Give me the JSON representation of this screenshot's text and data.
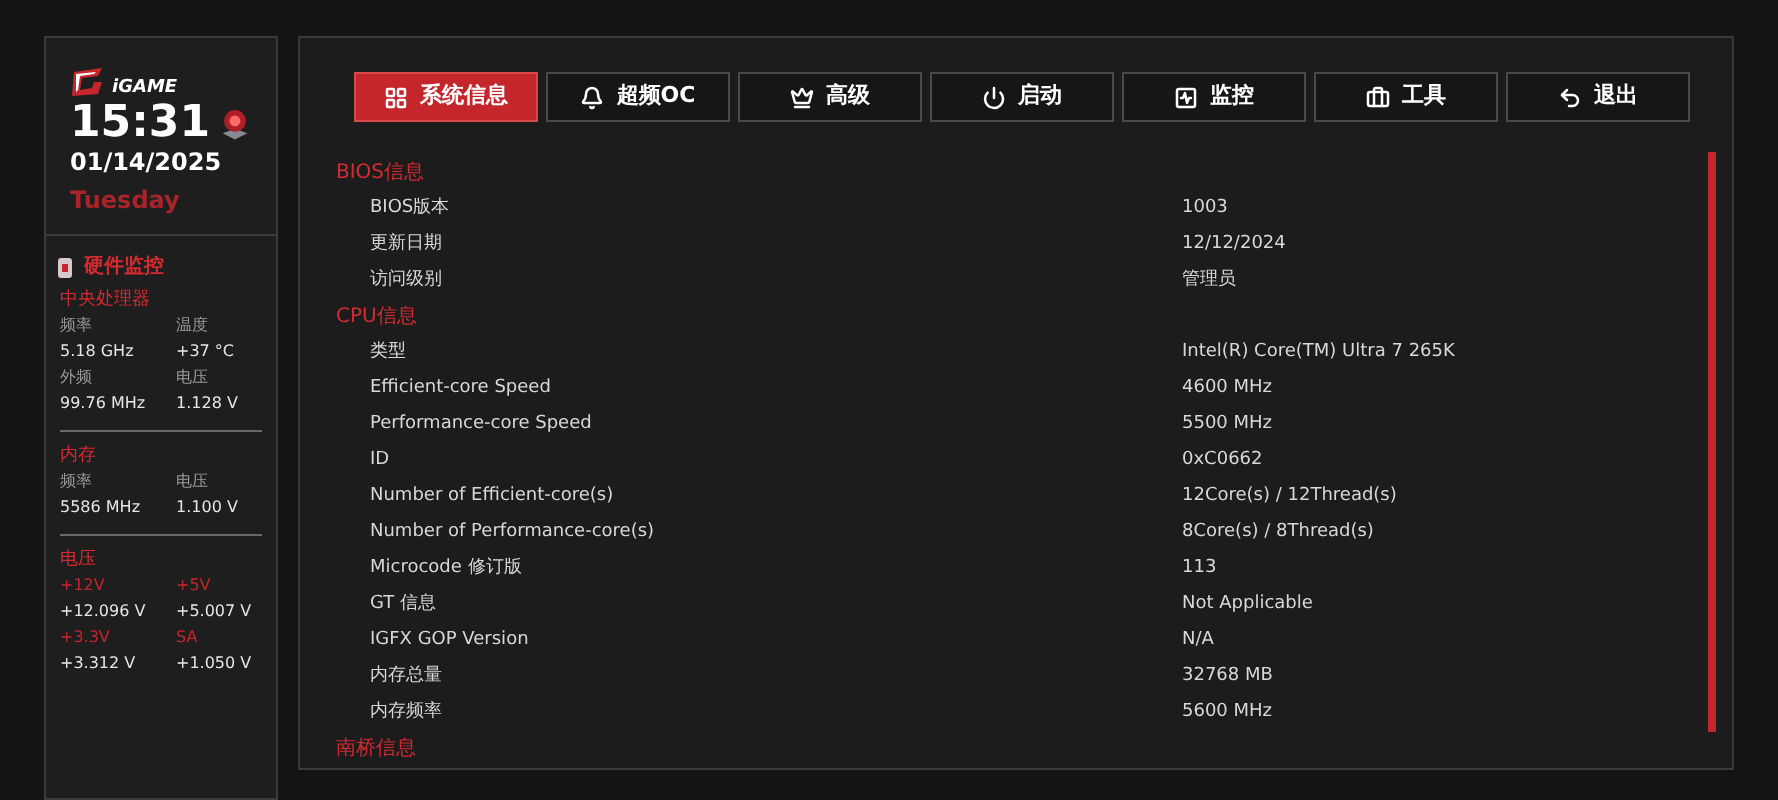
{
  "sidebar": {
    "logo": "iGAME",
    "time": "15:31",
    "date": "01/14/2025",
    "weekday": "Tuesday",
    "monitor_title": "硬件监控",
    "groups": [
      {
        "title": "中央处理器",
        "stats": [
          {
            "label": "频率",
            "value": "5.18 GHz",
            "kind": "plain"
          },
          {
            "label": "温度",
            "value": "+37 °C",
            "kind": "plain"
          },
          {
            "label": "外频",
            "value": "99.76 MHz",
            "kind": "plain"
          },
          {
            "label": "电压",
            "value": "1.128 V",
            "kind": "plain"
          }
        ]
      },
      {
        "title": "内存",
        "stats": [
          {
            "label": "频率",
            "value": "5586 MHz",
            "kind": "plain"
          },
          {
            "label": "电压",
            "value": "1.100 V",
            "kind": "plain"
          }
        ]
      },
      {
        "title": "电压",
        "stats": [
          {
            "label": "+12V",
            "value": "+12.096 V",
            "kind": "rail"
          },
          {
            "label": "+5V",
            "value": "+5.007 V",
            "kind": "rail"
          },
          {
            "label": "+3.3V",
            "value": "+3.312 V",
            "kind": "rail"
          },
          {
            "label": "SA",
            "value": "+1.050 V",
            "kind": "rail"
          }
        ]
      }
    ]
  },
  "tabs": [
    {
      "label": "系统信息",
      "selected": true
    },
    {
      "label": "超频OC",
      "selected": false
    },
    {
      "label": "高级",
      "selected": false
    },
    {
      "label": "启动",
      "selected": false
    },
    {
      "label": "监控",
      "selected": false
    },
    {
      "label": "工具",
      "selected": false
    },
    {
      "label": "退出",
      "selected": false
    }
  ],
  "sections": [
    {
      "title": "BIOS信息",
      "rows": [
        {
          "label": "BIOS版本",
          "value": "1003"
        },
        {
          "label": "更新日期",
          "value": "12/12/2024"
        },
        {
          "label": "访问级别",
          "value": "管理员"
        }
      ]
    },
    {
      "title": "CPU信息",
      "rows": [
        {
          "label": "类型",
          "value": "Intel(R) Core(TM) Ultra 7 265K"
        },
        {
          "label": "Efficient-core Speed",
          "value": "4600 MHz"
        },
        {
          "label": "Performance-core Speed",
          "value": "5500 MHz"
        },
        {
          "label": "ID",
          "value": "0xC0662"
        },
        {
          "label": "Number of Efficient-core(s)",
          "value": "12Core(s) / 12Thread(s)"
        },
        {
          "label": "Number of Performance-core(s)",
          "value": "8Core(s) / 8Thread(s)"
        },
        {
          "label": "Microcode 修订版",
          "value": "113"
        },
        {
          "label": "GT 信息",
          "value": "Not Applicable"
        },
        {
          "label": "IGFX GOP Version",
          "value": "N/A"
        },
        {
          "label": "内存总量",
          "value": "32768 MB"
        },
        {
          "label": "内存频率",
          "value": "5600 MHz"
        }
      ]
    },
    {
      "title": "南桥信息"
    }
  ]
}
